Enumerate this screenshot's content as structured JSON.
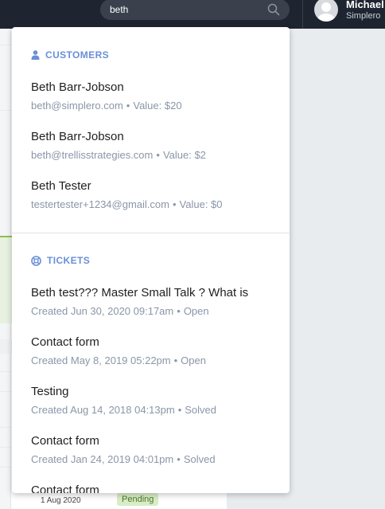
{
  "search": {
    "value": "beth",
    "icon": "search-icon"
  },
  "user": {
    "name": "Michael",
    "org": "Simplero"
  },
  "dropdown": {
    "customers_header": "CUSTOMERS",
    "customers": [
      {
        "name": "Beth Barr-Jobson",
        "email": "beth@simplero.com",
        "value": "Value: $20"
      },
      {
        "name": "Beth Barr-Jobson",
        "email": "beth@trellisstrategies.com",
        "value": "Value: $2"
      },
      {
        "name": "Beth Tester",
        "email": "testertester+1234@gmail.com",
        "value": "Value: $0"
      }
    ],
    "tickets_header": "TICKETS",
    "tickets": [
      {
        "title": "Beth test??? Master Small Talk ? What is",
        "created": "Created Jun 30, 2020 09:17am",
        "status": "Open"
      },
      {
        "title": "Contact form",
        "created": "Created May 8, 2019 05:22pm",
        "status": "Open"
      },
      {
        "title": "Testing",
        "created": "Created Aug 14, 2018 04:13pm",
        "status": "Solved"
      },
      {
        "title": "Contact form",
        "created": "Created Jan 24, 2019 04:01pm",
        "status": "Solved"
      },
      {
        "title": "Contact form",
        "created": "",
        "status": ""
      }
    ],
    "separator": "•"
  },
  "background": {
    "date": "1 Aug 2020",
    "badge": "Pending"
  },
  "colors": {
    "accent": "#6a8fd8",
    "topbar": "#1f2530",
    "muted": "#8a96a8"
  }
}
